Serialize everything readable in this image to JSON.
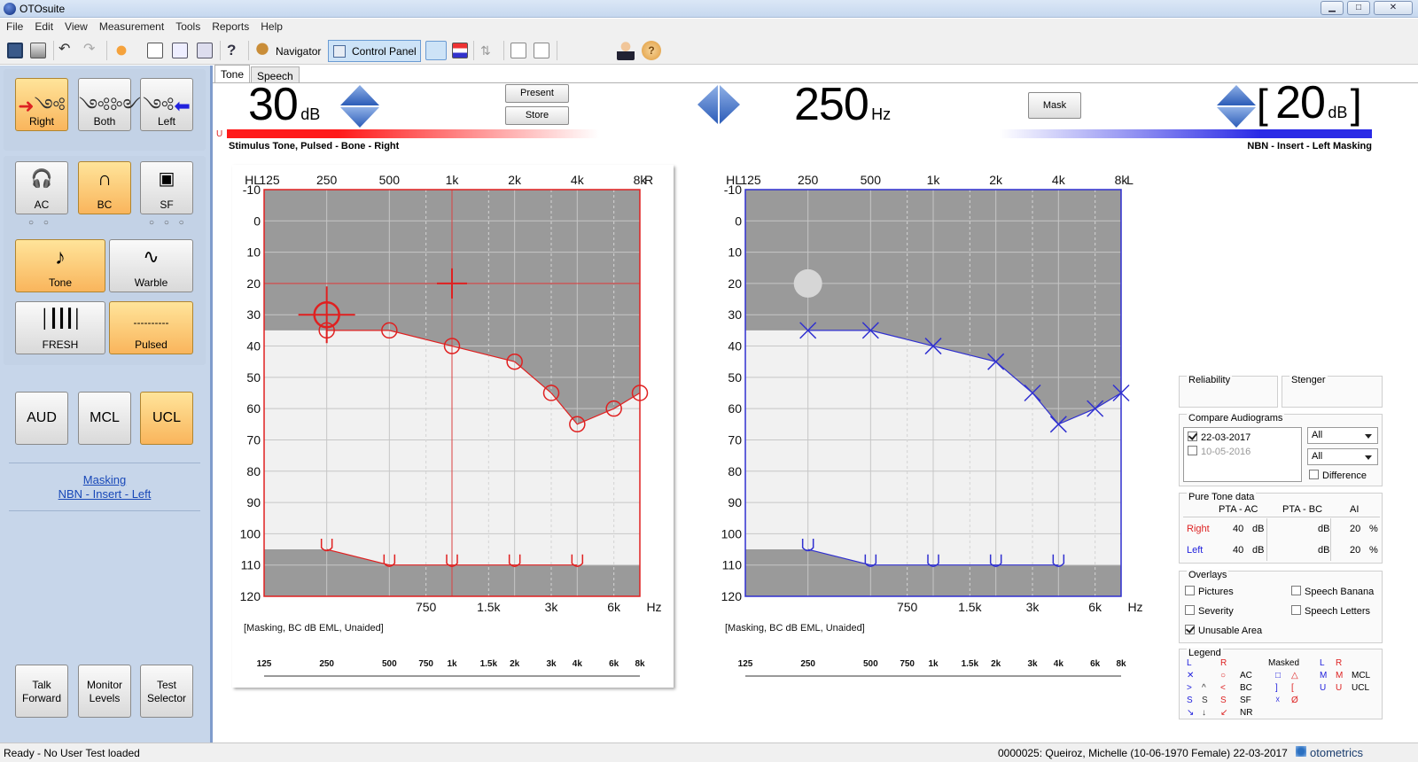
{
  "app": {
    "title": "OTOsuite",
    "controls": [
      "▁",
      "□",
      "✕"
    ]
  },
  "menu": [
    "File",
    "Edit",
    "View",
    "Measurement",
    "Tools",
    "Reports",
    "Help"
  ],
  "toolbar": {
    "navigator": "Navigator",
    "control_panel": "Control Panel"
  },
  "left_panel": {
    "ear": {
      "right": "Right",
      "both": "Both",
      "left": "Left"
    },
    "transducer": {
      "ac": "AC",
      "bc": "BC",
      "sf": "SF",
      "ac_dots": "○ ○",
      "sf_dots": "○ ○ ○"
    },
    "stimulus": {
      "tone": "Tone",
      "warble": "Warble",
      "fresh": "FRESH",
      "pulsed": "Pulsed",
      "pulsed_glyph": "----------"
    },
    "test": {
      "aud": "AUD",
      "mcl": "MCL",
      "ucl": "UCL"
    },
    "masking": {
      "line1": "Masking",
      "line2": "NBN - Insert - Left"
    },
    "bottom": {
      "talk": [
        "Talk",
        "Forward"
      ],
      "monitor": [
        "Monitor",
        "Levels"
      ],
      "selector": [
        "Test",
        "Selector"
      ]
    }
  },
  "tabs": [
    "Tone",
    "Speech"
  ],
  "control": {
    "stim_level": "30",
    "stim_unit": "dB",
    "present": "Present",
    "store": "Store",
    "frequency": "250",
    "freq_unit": "Hz",
    "mask": "Mask",
    "mask_level": "20",
    "mask_unit": "dB",
    "bracket_l": "[",
    "bracket_r": "]",
    "u_marker": "U",
    "stimulus_text": "Stimulus  Tone, Pulsed - Bone - Right",
    "masking_text": "NBN - Insert - Left  Masking"
  },
  "chart_data": [
    {
      "type": "line",
      "title": "",
      "ear": "Right",
      "ear_label": "R",
      "hl_label": "HL",
      "x_top": [
        "125",
        "250",
        "500",
        "1k",
        "2k",
        "4k",
        "8k"
      ],
      "x_mid": [
        "750",
        "1.5k",
        "3k",
        "6k"
      ],
      "x_unit": "Hz",
      "x_bottom": [
        "125",
        "250",
        "500",
        "750",
        "1k",
        "1.5k",
        "2k",
        "3k",
        "4k",
        "6k",
        "8k"
      ],
      "y_ticks": [
        "-10",
        "0",
        "10",
        "20",
        "30",
        "40",
        "50",
        "60",
        "70",
        "80",
        "90",
        "100",
        "110",
        "120"
      ],
      "ylim": [
        -10,
        120
      ],
      "series": [
        {
          "symbol": "circle",
          "x": [
            250,
            500,
            1000,
            2000,
            3000,
            4000,
            6000,
            8000
          ],
          "values": [
            35,
            35,
            40,
            45,
            55,
            65,
            60,
            55
          ]
        },
        {
          "symbol": "ucl",
          "x": [
            250,
            500,
            1000,
            2000,
            4000
          ],
          "values": [
            105,
            110,
            110,
            110,
            110
          ]
        }
      ],
      "cursor": {
        "freq": 250,
        "level": 30
      },
      "crosshair": {
        "freq": 1000,
        "level": 20
      },
      "note": "[Masking, BC dB EML, Unaided]",
      "color": "#e02020"
    },
    {
      "type": "line",
      "title": "",
      "ear": "Left",
      "ear_label": "L",
      "hl_label": "HL",
      "x_top": [
        "125",
        "250",
        "500",
        "1k",
        "2k",
        "4k",
        "8k"
      ],
      "x_mid": [
        "750",
        "1.5k",
        "3k",
        "6k"
      ],
      "x_unit": "Hz",
      "x_bottom": [
        "125",
        "250",
        "500",
        "750",
        "1k",
        "1.5k",
        "2k",
        "3k",
        "4k",
        "6k",
        "8k"
      ],
      "y_ticks": [
        "-10",
        "0",
        "10",
        "20",
        "30",
        "40",
        "50",
        "60",
        "70",
        "80",
        "90",
        "100",
        "110",
        "120"
      ],
      "ylim": [
        -10,
        120
      ],
      "series": [
        {
          "symbol": "cross",
          "x": [
            250,
            500,
            1000,
            2000,
            3000,
            4000,
            6000,
            8000
          ],
          "values": [
            35,
            35,
            40,
            45,
            55,
            65,
            60,
            55
          ]
        },
        {
          "symbol": "ucl",
          "x": [
            250,
            500,
            1000,
            2000,
            4000
          ],
          "values": [
            105,
            110,
            110,
            110,
            110
          ]
        }
      ],
      "dot": {
        "freq": 250,
        "level": 20
      },
      "note": "[Masking, BC dB EML, Unaided]",
      "color": "#3030d0"
    }
  ],
  "right_panel": {
    "reliability": "Reliability",
    "stenger": "Stenger",
    "compare": {
      "title": "Compare Audiograms",
      "dates": [
        "22-03-2017",
        "10-05-2016"
      ],
      "select1": "All",
      "select2": "All",
      "difference": "Difference"
    },
    "pure_tone": {
      "title": "Pure Tone data",
      "headers": [
        "PTA - AC",
        "PTA - BC",
        "AI"
      ],
      "rows": [
        {
          "ear": "Right",
          "ac": "40",
          "ac_u": "dB",
          "bc_u": "dB",
          "ai": "20",
          "ai_u": "%"
        },
        {
          "ear": "Left",
          "ac": "40",
          "ac_u": "dB",
          "bc_u": "dB",
          "ai": "20",
          "ai_u": "%"
        }
      ]
    },
    "overlays": {
      "title": "Overlays",
      "pictures": "Pictures",
      "speech_banana": "Speech Banana",
      "severity": "Severity",
      "speech_letters": "Speech Letters",
      "unusable": "Unusable Area"
    },
    "legend": {
      "title": "Legend",
      "L": "L",
      "R": "R",
      "masked": "Masked",
      "rows": [
        {
          "l": "✕",
          "r": "○",
          "lbl": "AC",
          "ml": "□",
          "mr": "△"
        },
        {
          "l": ">",
          "r": "^",
          "lbl": "BC",
          "ml": "]",
          "mr": "["
        },
        {
          "l": "S",
          "r": "S",
          "lbl": "SF",
          "ml": "☓",
          "mr": "Ø"
        },
        {
          "l": "↘",
          "r": "↙",
          "lbl": "NR",
          "ml": "",
          "mr": ""
        }
      ],
      "right_rows": [
        {
          "l": "M",
          "r": "M",
          "lbl": "MCL"
        },
        {
          "l": "U",
          "r": "U",
          "lbl": "UCL"
        }
      ],
      "bc_r": "<",
      "sf_r": "S",
      "nr_r": "↓"
    }
  },
  "status": {
    "left": "Ready - No User Test loaded",
    "patient": "0000025: Queiroz, Michelle (10-06-1970 Female)  22-03-2017",
    "brand": "otometrics"
  }
}
